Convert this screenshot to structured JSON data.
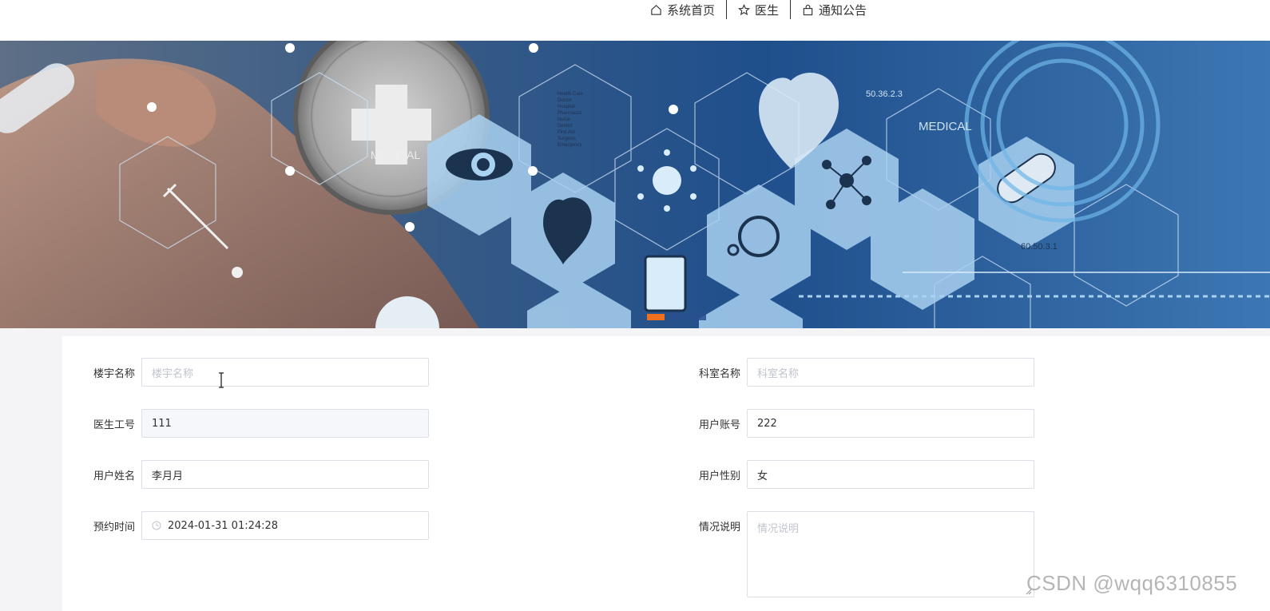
{
  "nav": {
    "items": [
      {
        "label": "系统首页",
        "icon": "home-icon"
      },
      {
        "label": "医生",
        "icon": "star-icon"
      },
      {
        "label": "通知公告",
        "icon": "bag-icon"
      }
    ]
  },
  "banner": {
    "text_medical_left": "MEDICAL",
    "text_medical_right": "MEDICAL",
    "text_code_1": "50.36.2.3",
    "text_code_2": "60.50.3.1",
    "text_list": [
      "Health Care",
      "Doctor",
      "Hospital",
      "Pharmacist",
      "Nurse",
      "Dentist",
      "First Aid",
      "Surgeon",
      "Emergency"
    ],
    "carousel": {
      "count": 3,
      "active_index": 0
    }
  },
  "form": {
    "building": {
      "label": "楼宇名称",
      "value": "",
      "placeholder": "楼宇名称"
    },
    "department": {
      "label": "科室名称",
      "value": "",
      "placeholder": "科室名称"
    },
    "doctor_id": {
      "label": "医生工号",
      "value": "111"
    },
    "user_account": {
      "label": "用户账号",
      "value": "222"
    },
    "user_name": {
      "label": "用户姓名",
      "value": "李月月"
    },
    "user_gender": {
      "label": "用户性别",
      "value": "女"
    },
    "appointment_time": {
      "label": "预约时间",
      "value": "2024-01-31 01:24:28"
    },
    "description": {
      "label": "情况说明",
      "value": "",
      "placeholder": "情况说明"
    }
  },
  "watermark": "CSDN @wqq6310855",
  "colors": {
    "accent_carousel": "#f07020",
    "banner_blue": "#1f4f8c"
  }
}
